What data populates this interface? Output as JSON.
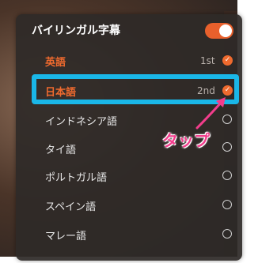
{
  "subtitle_menu": {
    "title": "バイリンガル字幕",
    "toggle_on": true,
    "accent_color": "#ef6a2e",
    "languages": [
      {
        "label": "英語",
        "order": "1st",
        "selected": true
      },
      {
        "label": "日本語",
        "order": "2nd",
        "selected": true
      },
      {
        "label": "インドネシア語",
        "order": "",
        "selected": false
      },
      {
        "label": "タイ語",
        "order": "",
        "selected": false
      },
      {
        "label": "ポルトガル語",
        "order": "",
        "selected": false
      },
      {
        "label": "スペイン語",
        "order": "",
        "selected": false
      },
      {
        "label": "マレー語",
        "order": "",
        "selected": false
      }
    ]
  },
  "annotation": {
    "callout_text": "タップ",
    "highlight_color": "#1ab7e8",
    "callout_color": "#f23d8c"
  }
}
